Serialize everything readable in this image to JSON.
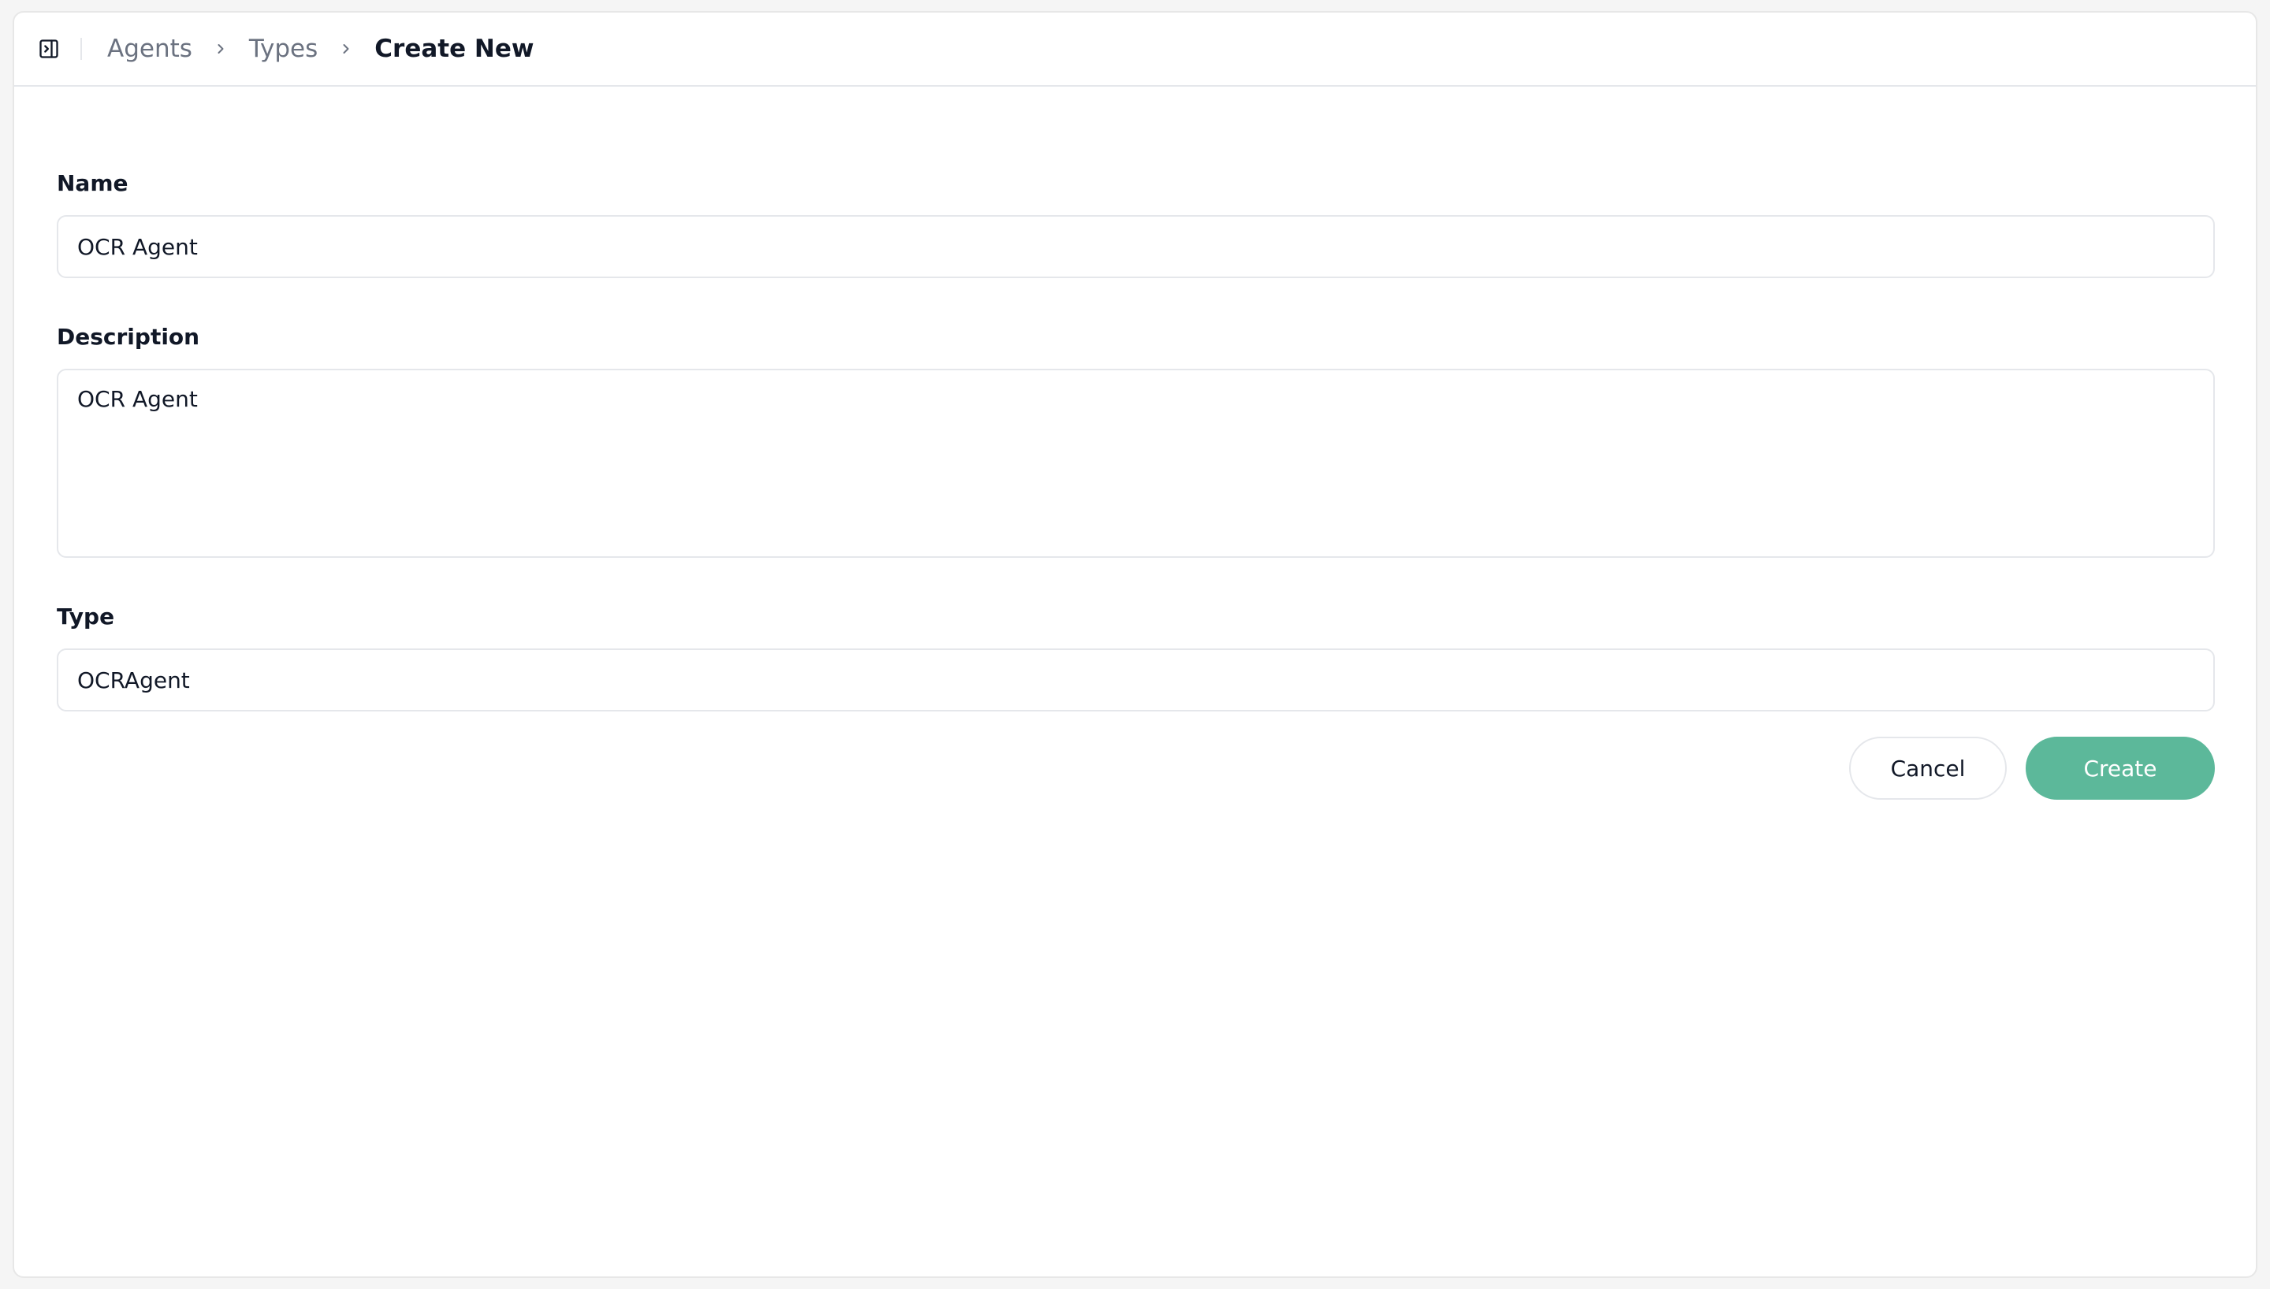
{
  "breadcrumb": {
    "items": [
      "Agents",
      "Types"
    ],
    "current": "Create New"
  },
  "icons": {
    "toggle": "sidebar-toggle-icon",
    "separator": "chevron-right-icon"
  },
  "form": {
    "name_label": "Name",
    "name_value": "OCR Agent",
    "description_label": "Description",
    "description_value": "OCR Agent",
    "type_label": "Type",
    "type_value": "OCRAgent"
  },
  "actions": {
    "cancel_label": "Cancel",
    "create_label": "Create"
  },
  "colors": {
    "accent": "#5cb89a",
    "border": "#e5e7eb",
    "muted_text": "#6b7280"
  }
}
